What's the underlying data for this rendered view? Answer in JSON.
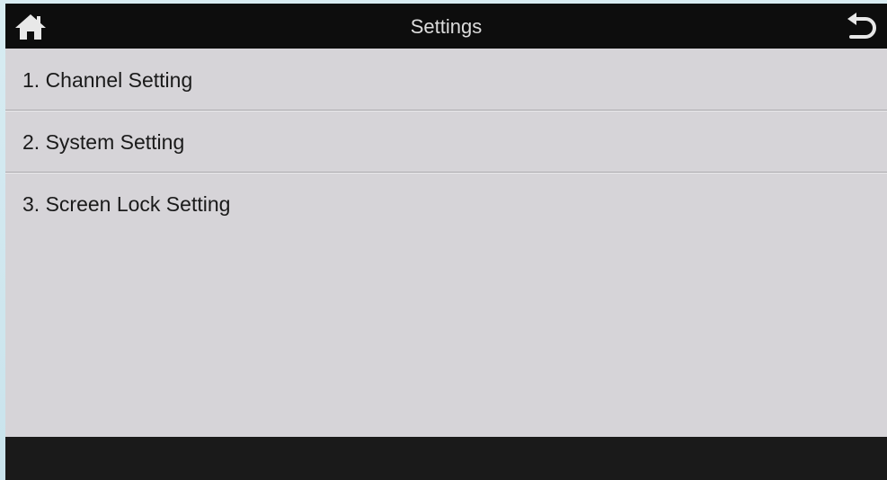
{
  "header": {
    "title": "Settings",
    "home_icon": "home-icon",
    "back_icon": "back-arrow-icon"
  },
  "menu": {
    "items": [
      {
        "label": "1. Channel Setting"
      },
      {
        "label": "2. System Setting"
      },
      {
        "label": "3. Screen Lock Setting"
      }
    ]
  },
  "colors": {
    "title_bar": "#0d0d0d",
    "background": "#d6d4d8",
    "bottom_bar": "#1a1a1a",
    "text": "#1a1a1a"
  }
}
